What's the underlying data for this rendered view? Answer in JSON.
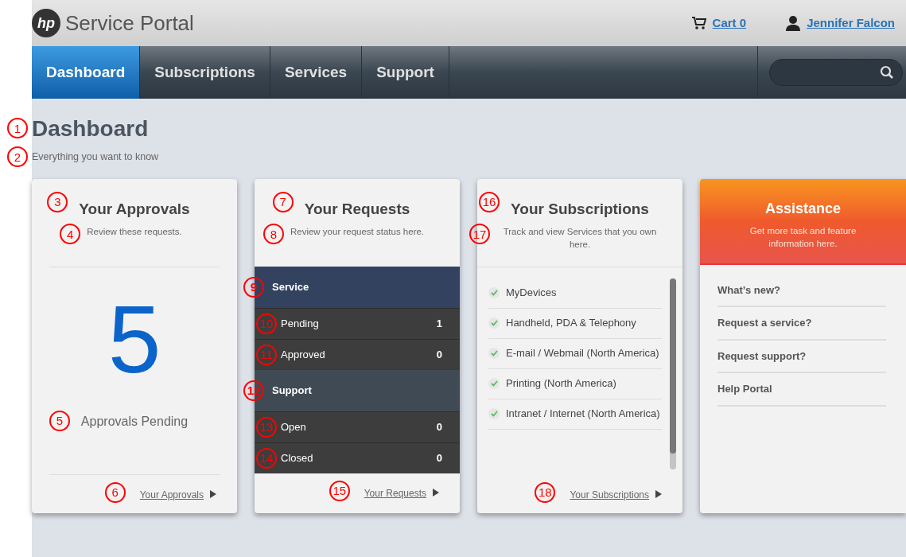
{
  "header": {
    "logo": "hp",
    "title": "Service Portal",
    "cart": "Cart 0",
    "user": "Jennifer Falcon"
  },
  "nav": {
    "tabs": [
      {
        "label": "Dashboard",
        "selected": true
      },
      {
        "label": "Subscriptions",
        "selected": false
      },
      {
        "label": "Services",
        "selected": false
      },
      {
        "label": "Support",
        "selected": false
      }
    ]
  },
  "page": {
    "title": "Dashboard",
    "title_marker": "1",
    "subtitle": "Everything you want to know",
    "subtitle_marker": "2"
  },
  "approvals": {
    "title": "Your Approvals",
    "title_marker": "3",
    "description": "Review these requests.",
    "description_marker": "4",
    "count": "5",
    "count_label": "Approvals Pending",
    "count_label_marker": "5",
    "link": "Your Approvals",
    "link_marker": "6"
  },
  "requests": {
    "title": "Your Requests",
    "title_marker": "7",
    "description": "Review your request status here.",
    "description_marker": "8",
    "groups": [
      {
        "name": "Service",
        "marker": "9",
        "color": "#33425e",
        "rows": [
          {
            "label": "Pending",
            "value": "1",
            "marker": "10"
          },
          {
            "label": "Approved",
            "value": "0",
            "marker": "11"
          }
        ]
      },
      {
        "name": "Support",
        "marker": "12",
        "color": "#3f4a54",
        "rows": [
          {
            "label": "Open",
            "value": "0",
            "marker": "13"
          },
          {
            "label": "Closed",
            "value": "0",
            "marker": "14"
          }
        ]
      }
    ],
    "link": "Your Requests",
    "link_marker": "15"
  },
  "subscriptions": {
    "title": "Your Subscriptions",
    "title_marker": "16",
    "description": "Track and view Services that you own here.",
    "description_marker": "17",
    "items": [
      {
        "label": "MyDevices",
        "checked": true
      },
      {
        "label": "Handheld, PDA & Telephony",
        "checked": true
      },
      {
        "label": "E-mail / Webmail (North America)",
        "checked": true
      },
      {
        "label": "Printing (North America)",
        "checked": true
      },
      {
        "label": "Intranet / Internet (North America)",
        "checked": true
      }
    ],
    "link": "Your Subscriptions",
    "link_marker": "18"
  },
  "assistance": {
    "title": "Assistance",
    "description": "Get more task and feature information here.",
    "links": [
      "What’s new?",
      "Request a service?",
      "Request support?",
      "Help Portal"
    ]
  }
}
